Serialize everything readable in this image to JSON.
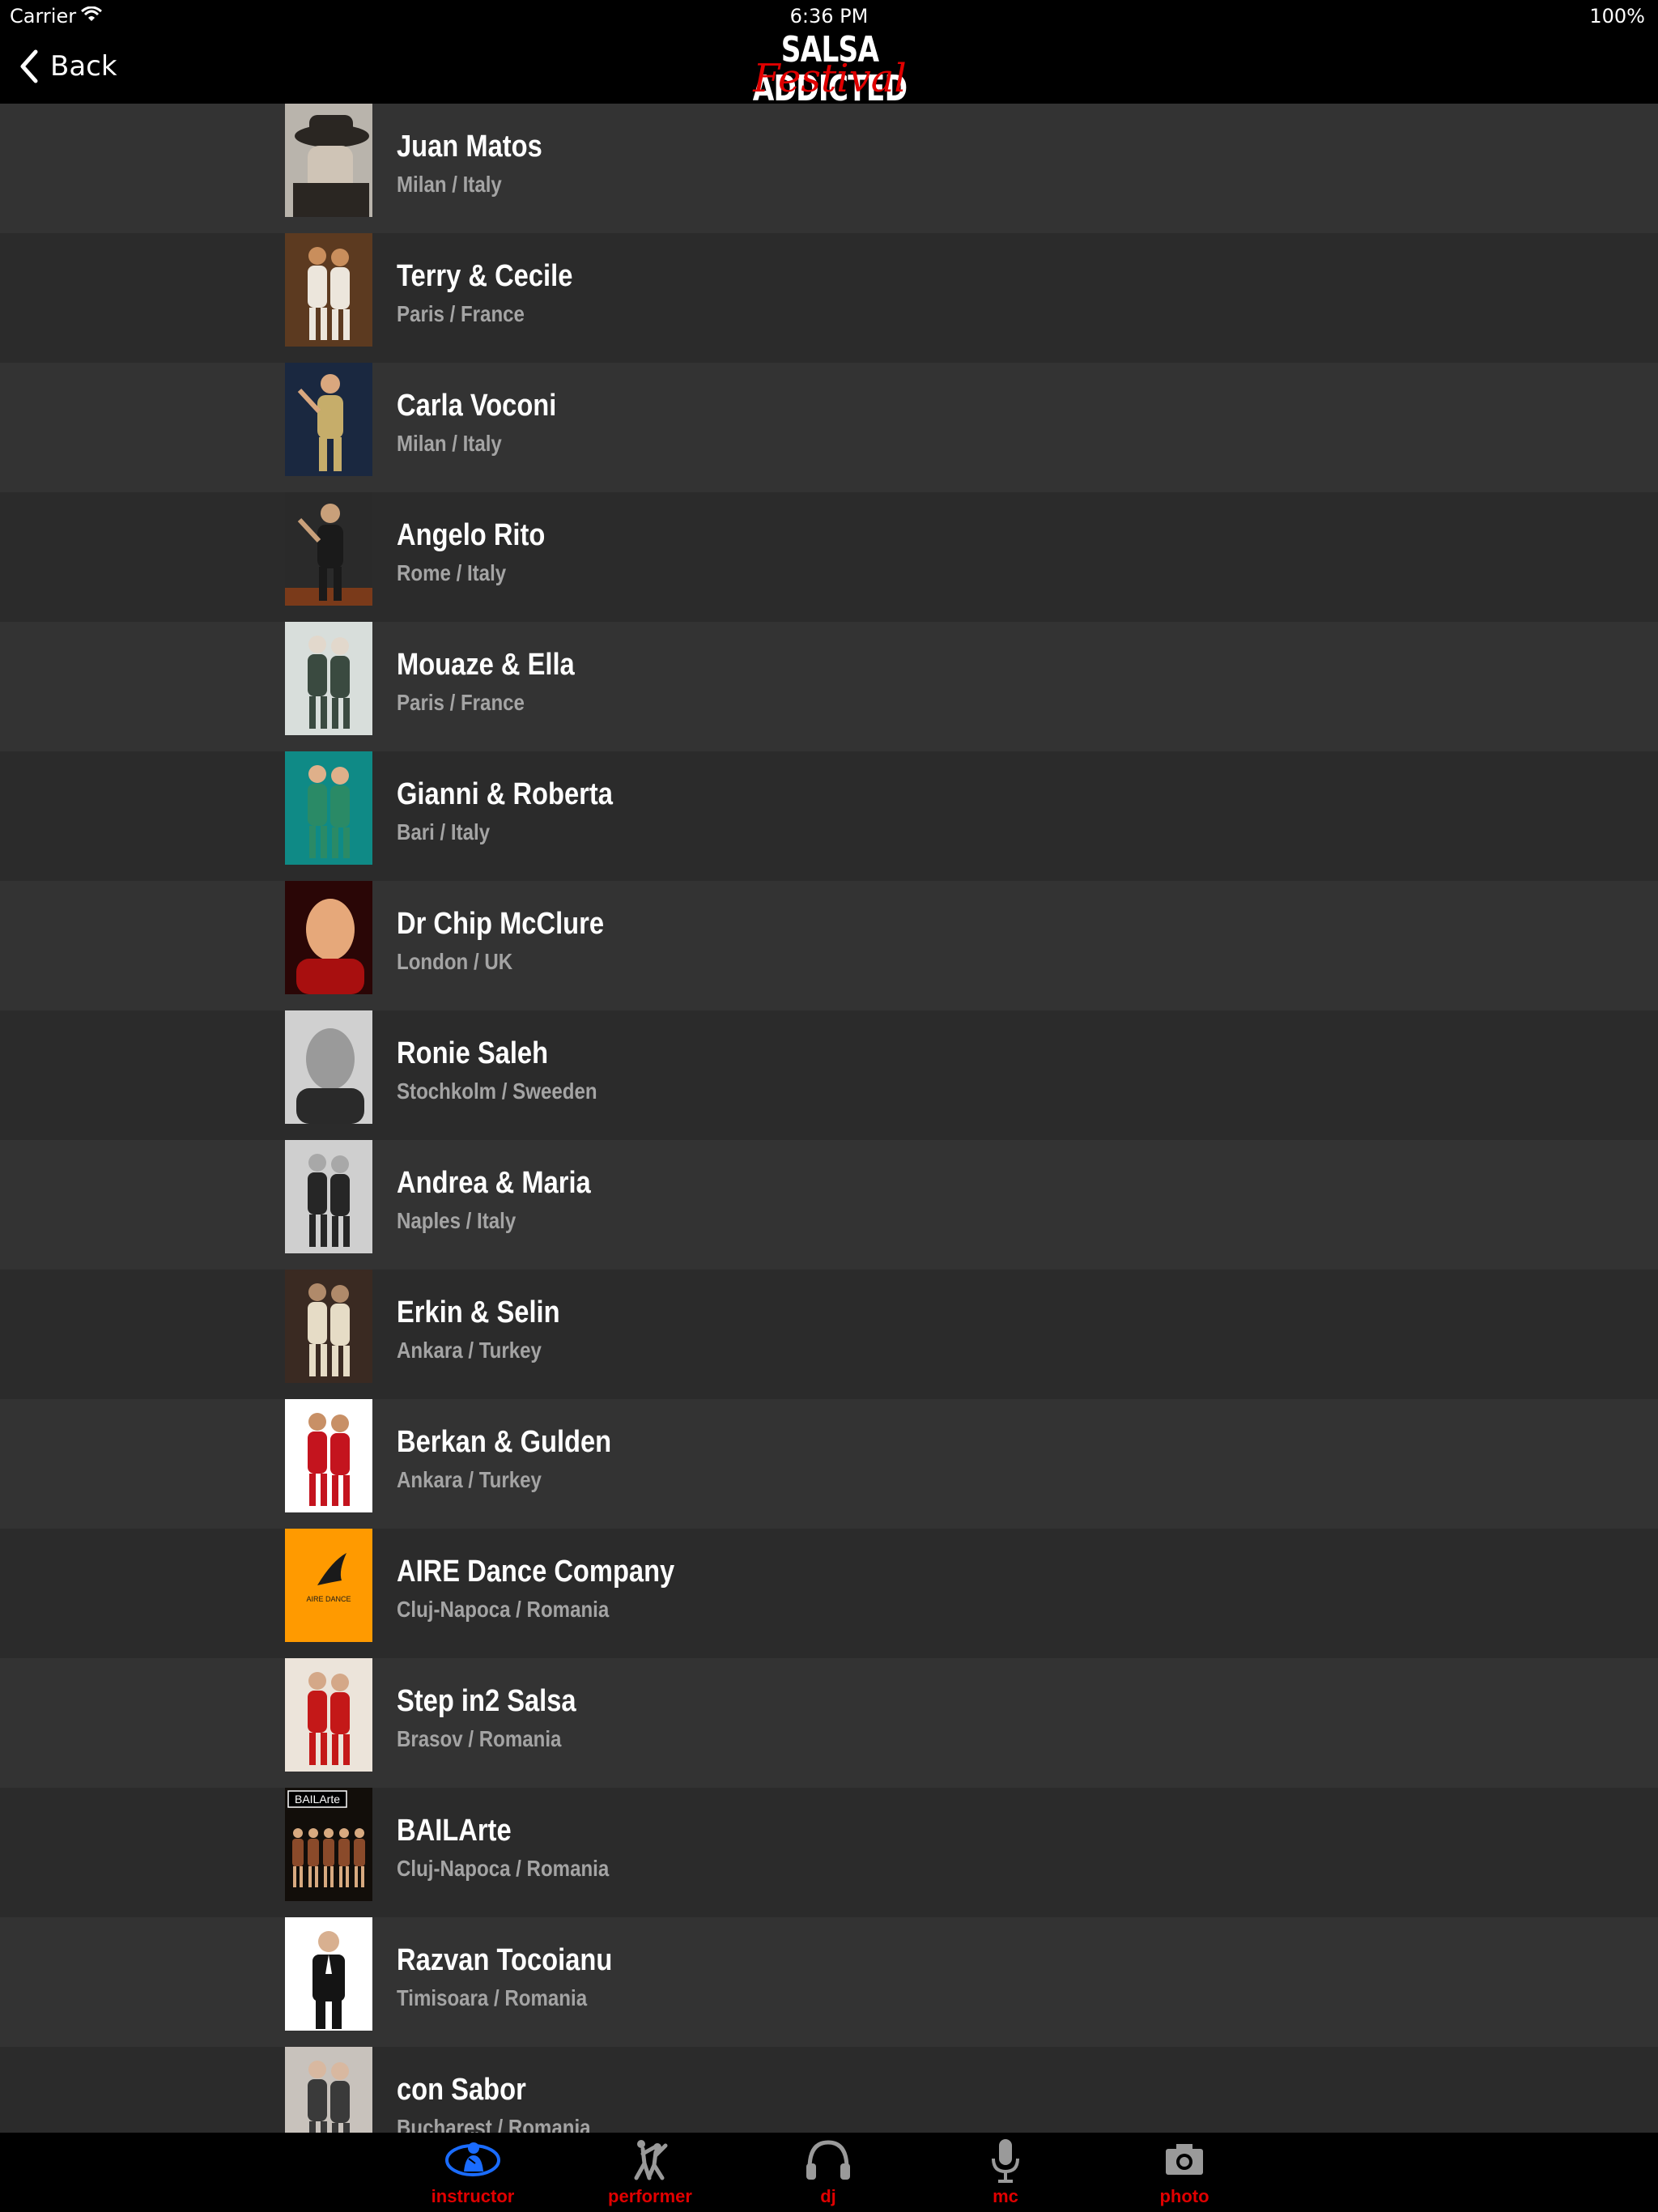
{
  "status_bar": {
    "carrier": "Carrier",
    "time": "6:36 PM",
    "battery": "100%"
  },
  "nav": {
    "back_label": "Back",
    "logo_top": "SALSA ADDICTED",
    "logo_bottom": "Festival"
  },
  "artists": [
    {
      "name": "Juan Matos",
      "location": "Milan / Italy"
    },
    {
      "name": "Terry & Cecile",
      "location": "Paris / France"
    },
    {
      "name": "Carla Voconi",
      "location": "Milan / Italy"
    },
    {
      "name": "Angelo Rito",
      "location": "Rome / Italy"
    },
    {
      "name": "Mouaze & Ella",
      "location": "Paris / France"
    },
    {
      "name": "Gianni & Roberta",
      "location": "Bari / Italy"
    },
    {
      "name": "Dr Chip McClure",
      "location": "London / UK"
    },
    {
      "name": "Ronie Saleh",
      "location": "Stochkolm / Sweeden"
    },
    {
      "name": "Andrea & Maria",
      "location": "Naples / Italy"
    },
    {
      "name": "Erkin & Selin",
      "location": "Ankara / Turkey"
    },
    {
      "name": "Berkan & Gulden",
      "location": "Ankara / Turkey"
    },
    {
      "name": "AIRE Dance Company",
      "location": "Cluj-Napoca / Romania"
    },
    {
      "name": "Step in2 Salsa",
      "location": "Brasov / Romania"
    },
    {
      "name": "BAILArte",
      "location": "Cluj-Napoca / Romania"
    },
    {
      "name": "Razvan Tocoianu",
      "location": "Timisoara / Romania"
    },
    {
      "name": "con Sabor",
      "location": "Bucharest / Romania"
    }
  ],
  "thumb_labels": {
    "bailarte": "BAILArte",
    "aire": "AIRE DANCE"
  },
  "tabs": [
    {
      "label": "instructor",
      "icon": "instructor-icon",
      "active": true
    },
    {
      "label": "performer",
      "icon": "performer-icon",
      "active": false
    },
    {
      "label": "dj",
      "icon": "headphones-icon",
      "active": false
    },
    {
      "label": "mc",
      "icon": "microphone-icon",
      "active": false
    },
    {
      "label": "photo",
      "icon": "camera-icon",
      "active": false
    }
  ],
  "colors": {
    "accent_red": "#e00000",
    "active_blue": "#1a6cff",
    "row_dark": "#2b2b2b",
    "row_light": "#333333"
  }
}
